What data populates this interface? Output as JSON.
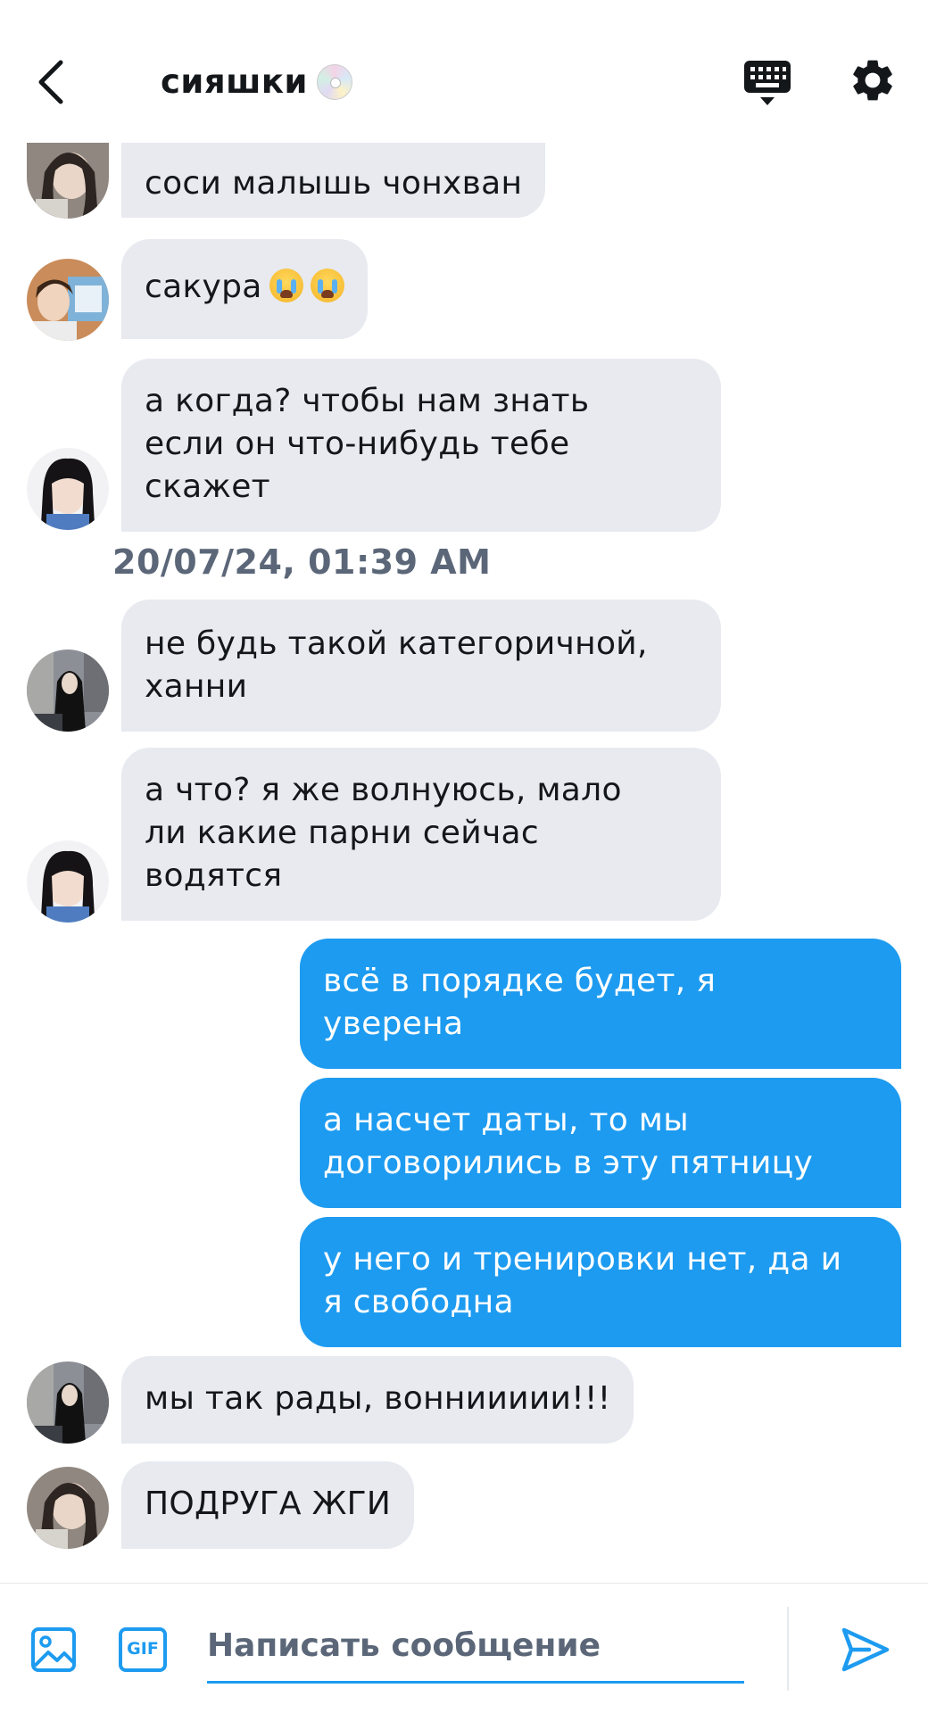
{
  "header": {
    "title": "сияшки",
    "title_icon": "disc-icon",
    "back_icon": "chevron-left-icon",
    "keyboard_icon": "keyboard-icon",
    "settings_icon": "gear-icon"
  },
  "messages": [
    {
      "side": "in",
      "avatar": "avatar-1",
      "text": "соси малышь чонхван"
    },
    {
      "side": "in",
      "avatar": "avatar-2",
      "text": "сакура",
      "emoji": [
        "loudly-crying-face",
        "loudly-crying-face"
      ]
    },
    {
      "side": "in",
      "avatar": "avatar-3",
      "lines": [
        "а когда? чтобы нам знать",
        "если он что-нибудь тебе",
        "скажет"
      ]
    },
    {
      "side": "in",
      "avatar": "avatar-4",
      "lines": [
        "не будь такой категоричной,",
        "ханни"
      ]
    },
    {
      "side": "in",
      "avatar": "avatar-3",
      "lines": [
        "а что? я же волнуюсь, мало",
        "ли какие парни сейчас",
        "водятся"
      ]
    },
    {
      "side": "out",
      "lines": [
        "всё в порядке будет, я",
        "уверена"
      ]
    },
    {
      "side": "out",
      "lines": [
        "а насчет даты, то мы",
        "договорились в эту пятницу"
      ]
    },
    {
      "side": "out",
      "lines": [
        "у него и тренировки нет, да и",
        "я свободна"
      ]
    },
    {
      "side": "in",
      "avatar": "avatar-4",
      "text": "мы так рады, вонниииии!!!"
    },
    {
      "side": "in",
      "avatar": "avatar-1",
      "text": "ПОДРУГА ЖГИ"
    }
  ],
  "timestamp": "20/07/24, 01:39 AM",
  "composer": {
    "placeholder": "Написать сообщение",
    "image_icon": "image-icon",
    "gif_label": "GIF",
    "send_icon": "send-icon"
  },
  "colors": {
    "accent": "#1d9bf0",
    "incoming_bubble": "#e8eaf0",
    "timestamp_text": "#5b6778"
  }
}
